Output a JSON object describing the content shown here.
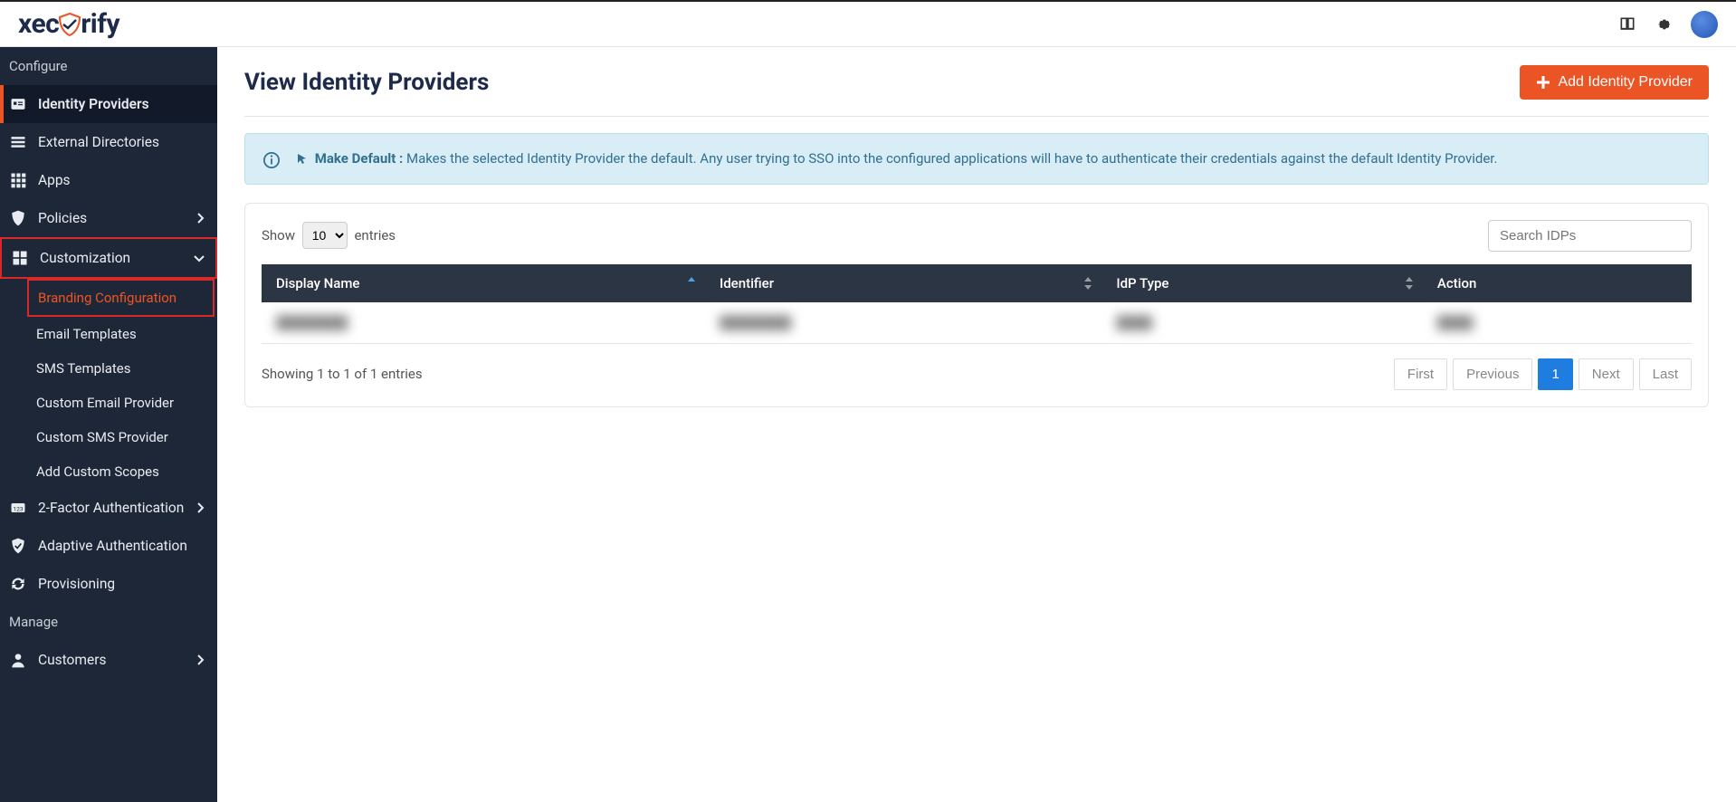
{
  "brand": {
    "name": "xecurify"
  },
  "sidebar": {
    "section_configure": "Configure",
    "section_manage": "Manage",
    "identity_providers": "Identity Providers",
    "external_directories": "External Directories",
    "apps": "Apps",
    "policies": "Policies",
    "customization": "Customization",
    "sub_branding": "Branding Configuration",
    "sub_email_templates": "Email Templates",
    "sub_sms_templates": "SMS Templates",
    "sub_custom_email_provider": "Custom Email Provider",
    "sub_custom_sms_provider": "Custom SMS Provider",
    "sub_add_custom_scopes": "Add Custom Scopes",
    "two_factor": "2-Factor Authentication",
    "adaptive_auth": "Adaptive Authentication",
    "provisioning": "Provisioning",
    "customers": "Customers"
  },
  "page": {
    "title": "View Identity Providers",
    "add_btn": "Add Identity Provider"
  },
  "info": {
    "label": "Make Default :",
    "text": "Makes the selected Identity Provider the default. Any user trying to SSO into the configured applications will have to authenticate their credentials against the default Identity Provider."
  },
  "table": {
    "show_label": "Show",
    "entries_label": "entries",
    "length_value": "10",
    "search_placeholder": "Search IDPs",
    "col_display_name": "Display Name",
    "col_identifier": "Identifier",
    "col_idp_type": "IdP Type",
    "col_action": "Action",
    "rows": [
      {
        "display": "████████",
        "identifier": "████████",
        "type": "████",
        "action": "████"
      }
    ],
    "summary": "Showing 1 to 1 of 1 entries",
    "pager_first": "First",
    "pager_prev": "Previous",
    "pager_page": "1",
    "pager_next": "Next",
    "pager_last": "Last"
  }
}
